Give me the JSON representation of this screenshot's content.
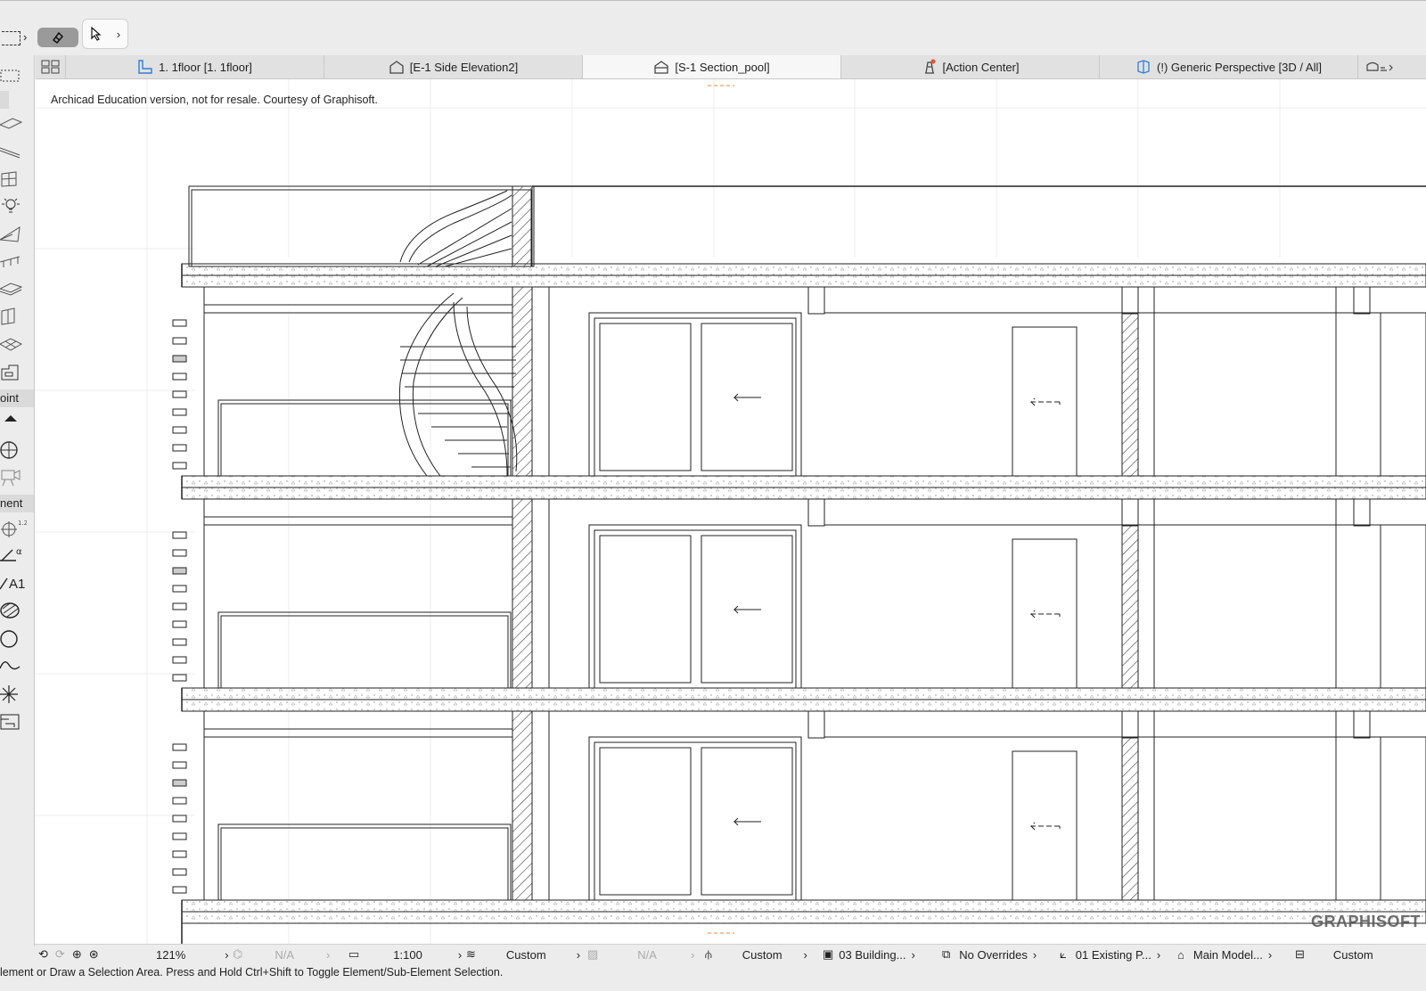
{
  "toolbar": {
    "marquee_chevron": "›",
    "arrow_chevron": "›"
  },
  "tabs": [
    {
      "label": "1. 1floor  [1. 1floor]",
      "icon": "floor-plan-icon",
      "active": false
    },
    {
      "label": "[E-1 Side Elevation2]",
      "icon": "elevation-icon",
      "active": false
    },
    {
      "label": "[S-1 Section_pool]",
      "icon": "section-icon",
      "active": true
    },
    {
      "label": "[Action Center]",
      "icon": "action-center-icon",
      "active": false
    },
    {
      "label": "(!) Generic Perspective [3D / All]",
      "icon": "3d-icon",
      "active": false
    }
  ],
  "toolbox": {
    "label_viewpoint": "oint",
    "label_document": "nent",
    "label_a1": "A1",
    "tools": [
      "marquee-icon",
      "wall-icon",
      "beam-icon",
      "slab-icon",
      "window-icon",
      "lamp-icon",
      "roof-icon",
      "railing-icon",
      "stair-icon",
      "curtain-wall-icon",
      "mesh-icon",
      "object-icon",
      "section-marker-icon",
      "camera-icon",
      "dimension-icon",
      "angle-icon",
      "text-icon",
      "fill-icon",
      "circle-icon",
      "spline-icon",
      "hotspot-icon",
      "drawing-icon"
    ]
  },
  "canvas": {
    "watermark": "Archicad Education version, not for resale. Courtesy of Graphisoft.",
    "brand": "GRAPHISOFT"
  },
  "statusbar": {
    "zoom": "121%",
    "pen_na": "N/A",
    "scale": "1:100",
    "layer_combo": "Custom",
    "fill_na": "N/A",
    "pen_set": "Custom",
    "renovation": "03 Building...",
    "overrides": "No Overrides",
    "model_view": "01 Existing P...",
    "structure": "Main Model...",
    "dimension": "Custom"
  },
  "hint": "lement or Draw a Selection Area. Press and Hold Ctrl+Shift to Toggle Element/Sub-Element Selection.",
  "colors": {
    "accent_blue": "#2f7fd6",
    "active_tab": "#f7f7f7",
    "alert_dot": "#e8532d",
    "orange_marker": "#f0a060"
  }
}
